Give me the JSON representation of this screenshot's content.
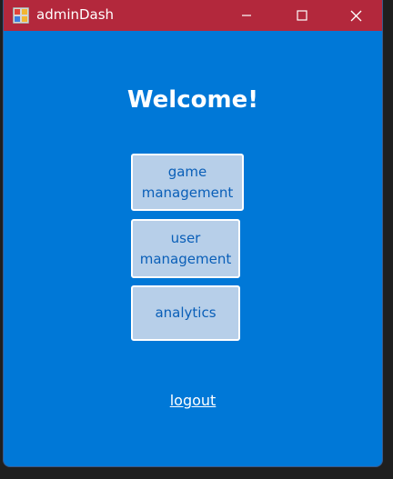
{
  "window": {
    "title": "adminDash",
    "icon": "app-icon",
    "controls": {
      "minimize": "minimize-icon",
      "maximize": "maximize-icon",
      "close": "close-icon"
    },
    "titlebar_color": "#b3283c",
    "background_color": "#0078d7"
  },
  "main": {
    "heading": "Welcome!",
    "buttons": [
      {
        "label": "game\nmanagement"
      },
      {
        "label": "user\nmanagement"
      },
      {
        "label": "analytics"
      }
    ],
    "logout_label": "logout"
  }
}
